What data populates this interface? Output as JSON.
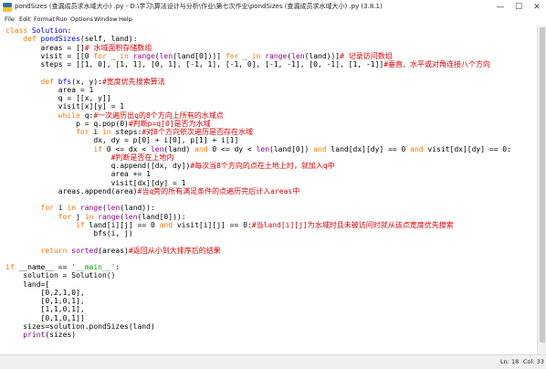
{
  "window": {
    "title": "pondSizes (查漏成员求水域大小) .py - D:\\学习\\算法设计与分析\\作业\\第七次作业\\pondSizes (查漏成员求水域大小) .py (3.8.1)",
    "minimize_glyph": "—",
    "maximize_glyph": "☐",
    "close_glyph": "✕"
  },
  "menu": [
    "File",
    "Edit",
    "Format",
    "Run",
    "Options",
    "Window",
    "Help"
  ],
  "status": {
    "line": "Ln: 18",
    "col": "Col: 33"
  },
  "colors": {
    "keyword": "#ff7700",
    "builtin": "#900090",
    "string": "#00aa00",
    "comment": "#dd0000",
    "definition": "#0000ff",
    "normal": "#000000"
  },
  "code_lines": [
    [
      [
        "k",
        "class "
      ],
      [
        "d",
        "Solution"
      ],
      [
        "n",
        ":"
      ]
    ],
    [
      [
        "n",
        "    "
      ],
      [
        "k",
        "def "
      ],
      [
        "d",
        "pondSizes"
      ],
      [
        "n",
        "(self, land):"
      ]
    ],
    [
      [
        "n",
        "        areas = []"
      ],
      [
        "c",
        "# 水域面积存储数组"
      ]
    ],
    [
      [
        "n",
        "        visit = [[0 "
      ],
      [
        "k",
        "for "
      ],
      [
        "n",
        "_ "
      ],
      [
        "k",
        "in "
      ],
      [
        "b",
        "range"
      ],
      [
        "n",
        "("
      ],
      [
        "b",
        "len"
      ],
      [
        "n",
        "(land[0]))] "
      ],
      [
        "k",
        "for "
      ],
      [
        "n",
        "_ "
      ],
      [
        "k",
        "in "
      ],
      [
        "b",
        "range"
      ],
      [
        "n",
        "("
      ],
      [
        "b",
        "len"
      ],
      [
        "n",
        "(land))]"
      ],
      [
        "c",
        "# 记录访问数组"
      ]
    ],
    [
      [
        "n",
        "        steps = [[1, 0], [1, 1], [0, 1], [-1, 1], [-1, 0], [-1, -1], [0, -1], [1, -1]]"
      ],
      [
        "c",
        "#垂直、水平或对角连接八个方向"
      ]
    ],
    [
      [
        "n",
        ""
      ]
    ],
    [
      [
        "n",
        "        "
      ],
      [
        "k",
        "def "
      ],
      [
        "d",
        "bfs"
      ],
      [
        "n",
        "(x, y):"
      ],
      [
        "c",
        "#宽度优先搜索算法"
      ]
    ],
    [
      [
        "n",
        "            area = 1"
      ]
    ],
    [
      [
        "n",
        "            q = [[x, y]]"
      ]
    ],
    [
      [
        "n",
        "            visit[x][y] = 1"
      ]
    ],
    [
      [
        "n",
        "            "
      ],
      [
        "k",
        "while "
      ],
      [
        "n",
        "q:"
      ],
      [
        "c",
        "#一次遍历出q的8个方向上所有的水域点"
      ]
    ],
    [
      [
        "n",
        "                p = q.pop(0)"
      ],
      [
        "c",
        "#判断p=q[0]是否为水域"
      ]
    ],
    [
      [
        "n",
        "                "
      ],
      [
        "k",
        "for "
      ],
      [
        "n",
        "i "
      ],
      [
        "k",
        "in "
      ],
      [
        "n",
        "steps:"
      ],
      [
        "c",
        "#对8个方向依次遍历是否存在水域"
      ]
    ],
    [
      [
        "n",
        "                    dx, dy = p[0] + i[0], p[1] + i[1]"
      ]
    ],
    [
      [
        "n",
        "                    "
      ],
      [
        "k",
        "if "
      ],
      [
        "n",
        "0 <= dx < "
      ],
      [
        "b",
        "len"
      ],
      [
        "n",
        "(land) "
      ],
      [
        "k",
        "and "
      ],
      [
        "n",
        "0 <= dy < "
      ],
      [
        "b",
        "len"
      ],
      [
        "n",
        "(land[0]) "
      ],
      [
        "k",
        "and "
      ],
      [
        "n",
        "land[dx][dy] == 0 "
      ],
      [
        "k",
        "and "
      ],
      [
        "n",
        "visit[dx][dy] == 0:"
      ]
    ],
    [
      [
        "n",
        "                        "
      ],
      [
        "c",
        "#判断是否在上地内"
      ]
    ],
    [
      [
        "n",
        "                        q.append([dx, dy])"
      ],
      [
        "c",
        "#每次当8个方向的点在土地上时，就加入q中"
      ]
    ],
    [
      [
        "n",
        "                        area += 1"
      ]
    ],
    [
      [
        "n",
        "                        visit[dx][dy] = 1"
      ]
    ],
    [
      [
        "n",
        "            areas.append(area)"
      ],
      [
        "c",
        "#当q旁的所有满足条件的点遍历完后计入areas中"
      ]
    ],
    [
      [
        "n",
        ""
      ]
    ],
    [
      [
        "n",
        "        "
      ],
      [
        "k",
        "for "
      ],
      [
        "n",
        "i "
      ],
      [
        "k",
        "in "
      ],
      [
        "b",
        "range"
      ],
      [
        "n",
        "("
      ],
      [
        "b",
        "len"
      ],
      [
        "n",
        "(land)):"
      ]
    ],
    [
      [
        "n",
        "            "
      ],
      [
        "k",
        "for "
      ],
      [
        "n",
        "j "
      ],
      [
        "k",
        "in "
      ],
      [
        "b",
        "range"
      ],
      [
        "n",
        "("
      ],
      [
        "b",
        "len"
      ],
      [
        "n",
        "(land[0])):"
      ]
    ],
    [
      [
        "n",
        "                "
      ],
      [
        "k",
        "if "
      ],
      [
        "n",
        "land[i][j] == 0 "
      ],
      [
        "k",
        "and "
      ],
      [
        "n",
        "visit[i][j] == 0:"
      ],
      [
        "c",
        "#当land[i][j]为水域时且未被访问时就从该点宽度优先搜索"
      ]
    ],
    [
      [
        "n",
        "                    bfs(i, j)"
      ]
    ],
    [
      [
        "n",
        ""
      ]
    ],
    [
      [
        "n",
        "        "
      ],
      [
        "k",
        "return "
      ],
      [
        "b",
        "sorted"
      ],
      [
        "n",
        "(areas)"
      ],
      [
        "c",
        "#返回从小到大排序后的结果"
      ]
    ],
    [
      [
        "n",
        ""
      ]
    ],
    [
      [
        "k",
        "if "
      ],
      [
        "n",
        "__name__ == "
      ],
      [
        "s",
        "'__main__'"
      ],
      [
        "n",
        ":"
      ]
    ],
    [
      [
        "n",
        "    solution = Solution()"
      ]
    ],
    [
      [
        "n",
        "    land=["
      ]
    ],
    [
      [
        "n",
        "        [0,2,1,0],"
      ]
    ],
    [
      [
        "n",
        "        [0,1,0,1],"
      ]
    ],
    [
      [
        "n",
        "        [1,1,0,1],"
      ]
    ],
    [
      [
        "n",
        "        [0,1,0,1]]"
      ]
    ],
    [
      [
        "n",
        "    sizes=solution.pondSizes(land)"
      ]
    ],
    [
      [
        "n",
        "    "
      ],
      [
        "b",
        "print"
      ],
      [
        "n",
        "(sizes)"
      ]
    ]
  ]
}
